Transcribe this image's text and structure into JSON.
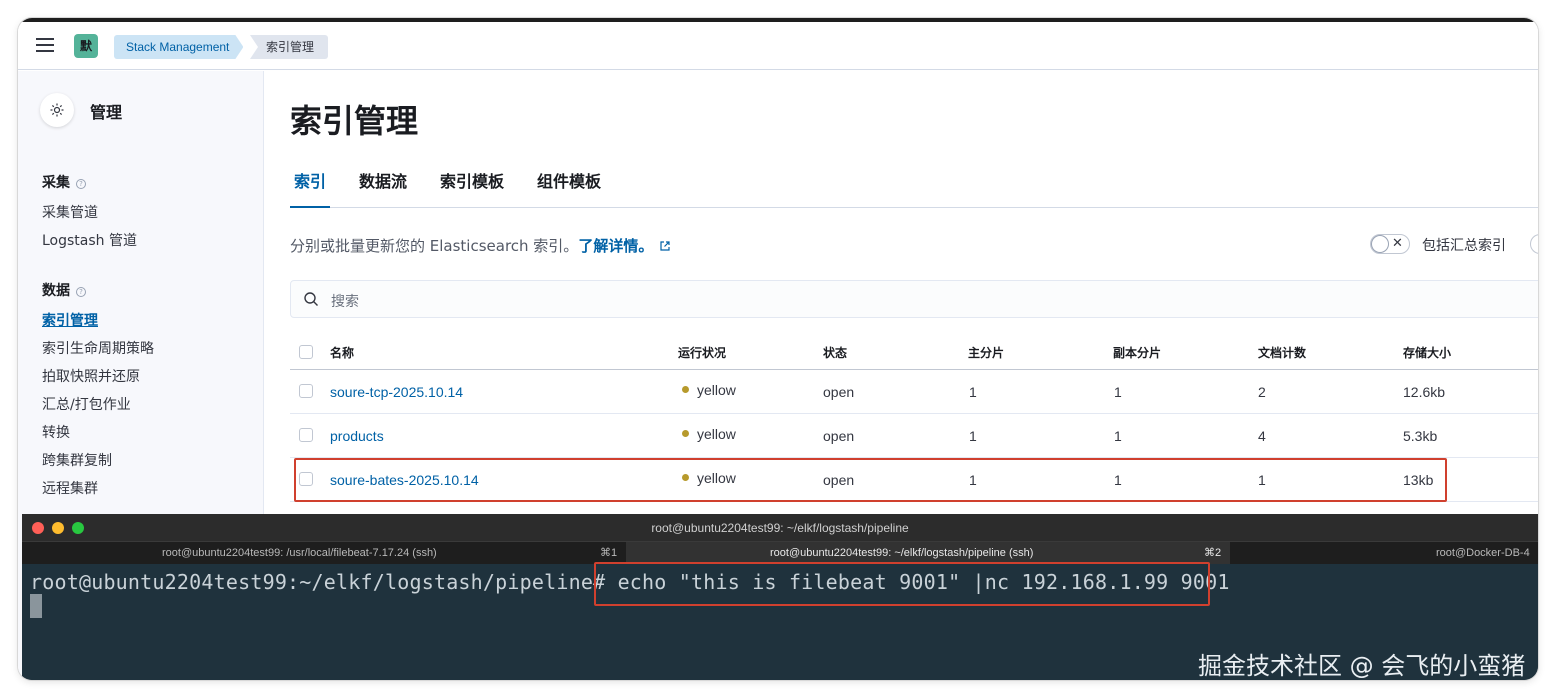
{
  "header": {
    "space_initial": "默",
    "breadcrumbs": [
      "Stack Management",
      "索引管理"
    ]
  },
  "sidebar": {
    "title": "管理",
    "groups": [
      {
        "label": "采集",
        "items": [
          "采集管道",
          "Logstash 管道"
        ]
      },
      {
        "label": "数据",
        "items": [
          "索引管理",
          "索引生命周期策略",
          "拍取快照并还原",
          "汇总/打包作业",
          "转换",
          "跨集群复制",
          "远程集群"
        ]
      }
    ],
    "active_item": "索引管理"
  },
  "main": {
    "title": "索引管理",
    "tabs": [
      "索引",
      "数据流",
      "索引模板",
      "组件模板"
    ],
    "active_tab": "索引",
    "description": "分别或批量更新您的 Elasticsearch 索引。",
    "description_link": "了解详情。",
    "toggle_label": "包括汇总索引",
    "search_placeholder": "搜索"
  },
  "table": {
    "columns": [
      "名称",
      "运行状况",
      "状态",
      "主分片",
      "副本分片",
      "文档计数",
      "存储大小"
    ],
    "rows": [
      {
        "name": "soure-tcp-2025.10.14",
        "health": "yellow",
        "status": "open",
        "primary": "1",
        "replica": "1",
        "docs": "2",
        "size": "12.6kb"
      },
      {
        "name": "products",
        "health": "yellow",
        "status": "open",
        "primary": "1",
        "replica": "1",
        "docs": "4",
        "size": "5.3kb"
      },
      {
        "name": "soure-bates-2025.10.14",
        "health": "yellow",
        "status": "open",
        "primary": "1",
        "replica": "1",
        "docs": "1",
        "size": "13kb"
      }
    ]
  },
  "terminal": {
    "window_title": "root@ubuntu2204test99: ~/elkf/logstash/pipeline",
    "tabs": [
      {
        "title": "root@ubuntu2204test99: /usr/local/filebeat-7.17.24 (ssh)",
        "key": "⌘1"
      },
      {
        "title": "root@ubuntu2204test99: ~/elkf/logstash/pipeline (ssh)",
        "key": "⌘2"
      },
      {
        "title": "root@Docker-DB-4",
        "key": ""
      }
    ],
    "prompt": "root@ubuntu2204test99:~/elkf/logstash/pipeline#",
    "command": " echo \"this is filebeat 9001\" |nc 192.168.1.99 9001"
  },
  "watermark": "掘金技术社区 @ 会飞的小蛮猪",
  "colors": {
    "accent": "#0061a6",
    "health_yellow": "#b79a2c",
    "highlight": "#d0402e",
    "terminal_bg": "#1f323d"
  }
}
